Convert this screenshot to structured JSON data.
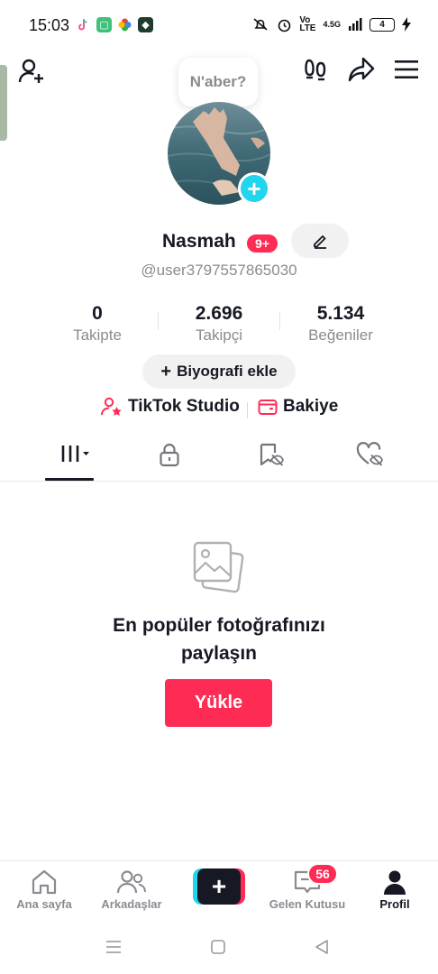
{
  "status_bar": {
    "time": "15:03",
    "network": "4.5G",
    "battery": "4"
  },
  "profile": {
    "note": "N'aber?",
    "name": "Nasmah",
    "badge": "9+",
    "handle": "@user3797557865030"
  },
  "stats": [
    {
      "value": "0",
      "label": "Takipte"
    },
    {
      "value": "2.696",
      "label": "Takipçi"
    },
    {
      "value": "5.134",
      "label": "Beğeniler"
    }
  ],
  "bio_button": "Biyografi ekle",
  "tools": {
    "studio": "TikTok Studio",
    "balance": "Bakiye"
  },
  "empty_state": {
    "title_line1": "En popüler fotoğrafınızı",
    "title_line2": "paylaşın",
    "upload": "Yükle"
  },
  "bottom_nav": {
    "home": "Ana sayfa",
    "friends": "Arkadaşlar",
    "inbox": "Gelen Kutusu",
    "inbox_badge": "56",
    "profile": "Profil"
  },
  "colors": {
    "accent": "#fe2c55",
    "cyan": "#20d5ec",
    "text": "#161823",
    "muted": "#8a8b91"
  }
}
